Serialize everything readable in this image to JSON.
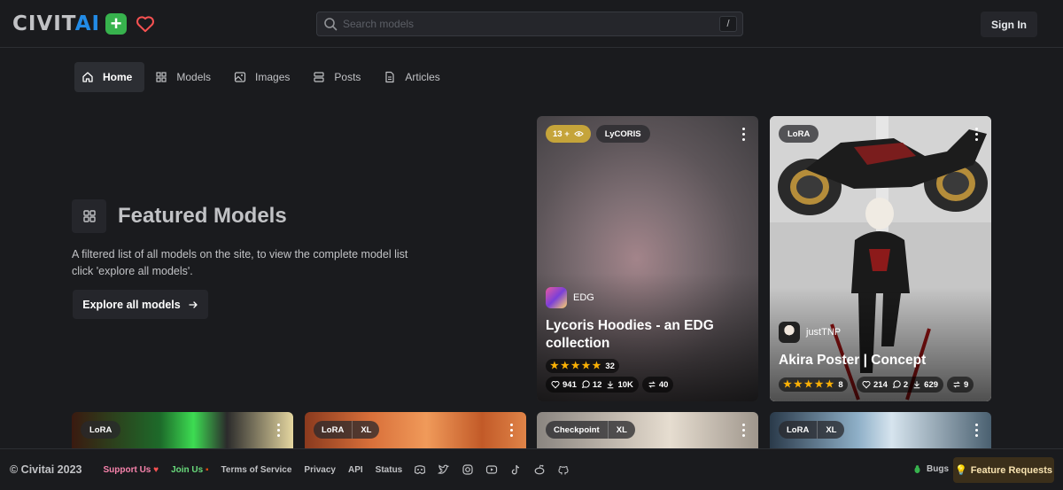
{
  "header": {
    "logo_text_civit": "CIVIT",
    "logo_text_ai": "AI",
    "search_placeholder": "Search models",
    "search_shortcut": "/",
    "signin_label": "Sign In"
  },
  "nav": {
    "items": [
      {
        "label": "Home",
        "icon": "home-icon",
        "active": true
      },
      {
        "label": "Models",
        "icon": "grid-icon"
      },
      {
        "label": "Images",
        "icon": "photo-icon"
      },
      {
        "label": "Posts",
        "icon": "layout-icon"
      },
      {
        "label": "Articles",
        "icon": "file-text-icon"
      }
    ]
  },
  "featured": {
    "title": "Featured Models",
    "description": "A filtered list of all models on the site, to view the complete model list click 'explore all models'.",
    "explore_label": "Explore all models"
  },
  "cards": [
    {
      "rating_badge": "13 +",
      "type": "LyCORIS",
      "creator": "EDG",
      "title": "Lycoris Hoodies - an EDG collection",
      "review_count": "32",
      "likes": "941",
      "comments": "12",
      "downloads": "10K",
      "buzz": "40"
    },
    {
      "type": "LoRA",
      "creator": "justTNP",
      "title": "Akira Poster | Concept",
      "review_count": "8",
      "likes": "214",
      "comments": "2",
      "downloads": "629",
      "buzz": "9"
    }
  ],
  "bottom_cards": [
    {
      "type": "LoRA",
      "extra": ""
    },
    {
      "type": "LoRA",
      "extra": "XL"
    },
    {
      "type": "Checkpoint",
      "extra": "XL"
    },
    {
      "type": "LoRA",
      "extra": "XL"
    }
  ],
  "footer": {
    "copyright": "© Civitai 2023",
    "support": "Support Us",
    "join": "Join Us",
    "terms": "Terms of Service",
    "privacy": "Privacy",
    "api": "API",
    "status": "Status",
    "bugs": "Bugs",
    "feature_requests": "Feature Requests"
  },
  "colors": {
    "background": "#1a1b1e",
    "surface": "#25262b",
    "accent_blue": "#228be6",
    "accent_green": "#37b24d",
    "star": "#fab005"
  }
}
